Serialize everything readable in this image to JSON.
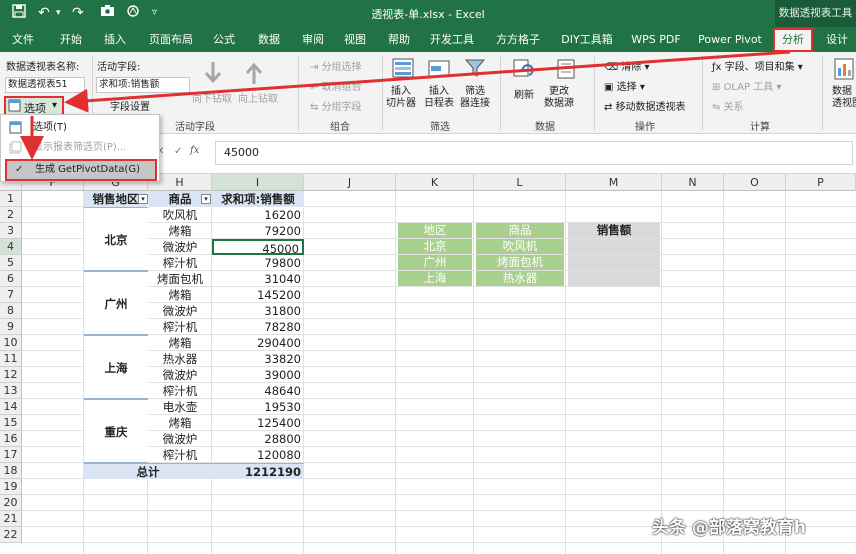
{
  "titlebar": {
    "title": "透视表-单.xlsx - Excel",
    "context_title": "数据透视表工具"
  },
  "tabs": [
    "文件",
    "开始",
    "插入",
    "页面布局",
    "公式",
    "数据",
    "审阅",
    "视图",
    "帮助",
    "开发工具",
    "方方格子",
    "DIY工具箱",
    "WPS PDF",
    "Power Pivot",
    "分析",
    "设计"
  ],
  "ribbon": {
    "pivot_name_label": "数据透视表名称:",
    "pivot_name": "数据透视表51",
    "options_button": "选项",
    "active_field_label": "活动字段:",
    "active_field": "求和项:销售额",
    "field_settings": "字段设置",
    "drill_down": "向下钻取",
    "drill_up": "向上钻取",
    "active_field_group": "活动字段",
    "group_selection": "分组选择",
    "ungroup": "取消组合",
    "group_field": "分组字段",
    "group_group": "组合",
    "insert_slicer": "插入\n切片器",
    "insert_timeline": "插入\n日程表",
    "filter_connections": "筛选\n器连接",
    "filter_group": "筛选",
    "refresh": "刷新",
    "change_source": "更改\n数据源",
    "data_group": "数据",
    "clear": "清除",
    "select": "选择",
    "move_pivot": "移动数据透视表",
    "actions_group": "操作",
    "fields_items_sets": "字段、项目和集",
    "olap_tools": "OLAP 工具",
    "relationships": "关系",
    "calc_group": "计算",
    "pivot_chart": "数据\n透视图"
  },
  "dropdown": {
    "items": [
      "选项(T)",
      "显示报表筛选页(P)...",
      "生成 GetPivotData(G)"
    ],
    "checked": "✓"
  },
  "formula": {
    "fx": "fx",
    "value": "45000"
  },
  "columns": [
    "F",
    "G",
    "H",
    "I",
    "J",
    "K",
    "L",
    "M",
    "N",
    "O",
    "P"
  ],
  "rows": [
    "1",
    "2",
    "3",
    "4",
    "5",
    "6",
    "7",
    "8",
    "9",
    "10",
    "11",
    "12",
    "13",
    "14",
    "15",
    "16",
    "17",
    "18",
    "19",
    "20",
    "21",
    "22"
  ],
  "pivot": {
    "headers": [
      "销售地区",
      "商品",
      "求和项:销售额"
    ],
    "regions": [
      "北京",
      "广州",
      "上海",
      "重庆"
    ],
    "items": [
      [
        "吹风机",
        "16200"
      ],
      [
        "烤箱",
        "79200"
      ],
      [
        "微波炉",
        "45000"
      ],
      [
        "榨汁机",
        "79800"
      ],
      [
        "烤面包机",
        "31040"
      ],
      [
        "烤箱",
        "145200"
      ],
      [
        "微波炉",
        "31800"
      ],
      [
        "榨汁机",
        "78280"
      ],
      [
        "烤箱",
        "290400"
      ],
      [
        "热水器",
        "33820"
      ],
      [
        "微波炉",
        "39000"
      ],
      [
        "榨汁机",
        "48640"
      ],
      [
        "电水壶",
        "19530"
      ],
      [
        "烤箱",
        "125400"
      ],
      [
        "微波炉",
        "28800"
      ],
      [
        "榨汁机",
        "120080"
      ]
    ],
    "total_label": "总计",
    "total": "1212190"
  },
  "lookup": {
    "headers": [
      "地区",
      "商品",
      "销售额"
    ],
    "rows": [
      [
        "北京",
        "吹风机"
      ],
      [
        "广州",
        "烤面包机"
      ],
      [
        "上海",
        "热水器"
      ]
    ]
  },
  "watermark": "头条 @部落窝教育h",
  "colors": {
    "excel_green": "#217346",
    "highlight_red": "#e03030",
    "pivot_header": "#dbe4f3",
    "lookup_green": "#a9d08e"
  }
}
